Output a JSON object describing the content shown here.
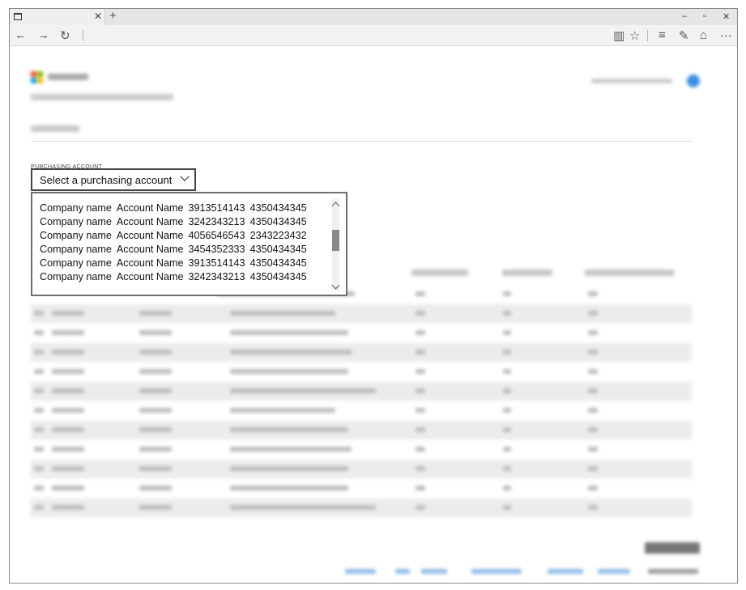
{
  "browser": {
    "icons": {
      "tab_page": "page-icon",
      "tab_close": "close-icon",
      "new_tab": "plus-icon",
      "back": "back-arrow-icon",
      "forward": "forward-arrow-icon",
      "refresh": "refresh-icon",
      "reading_view": "book-icon",
      "favorite": "star-icon",
      "hub": "hub-icon",
      "notes": "pen-icon",
      "share": "share-icon",
      "more": "more-icon"
    },
    "window_controls": {
      "minimize": "–",
      "restore": "▫",
      "close": "✕"
    }
  },
  "purchasing": {
    "label": "PURCHASING ACCOUNT",
    "select_placeholder": "Select a purchasing account",
    "options": [
      {
        "company": "Company name",
        "account": "Account Name",
        "num1": "3913514143",
        "num2": "4350434345"
      },
      {
        "company": "Company name",
        "account": "Account Name",
        "num1": "3242343213",
        "num2": "4350434345"
      },
      {
        "company": "Company name",
        "account": "Account Name",
        "num1": "4056546543",
        "num2": "2343223432"
      },
      {
        "company": "Company name",
        "account": "Account Name",
        "num1": "3454352333",
        "num2": "4350434345"
      },
      {
        "company": "Company name",
        "account": "Account Name",
        "num1": "3913514143",
        "num2": "4350434345"
      },
      {
        "company": "Company name",
        "account": "Account Name",
        "num1": "3242343213",
        "num2": "4350434345"
      }
    ]
  },
  "colors": {
    "accent_blue": "#3a8ee6",
    "link_blue": "#8fbbe6"
  }
}
